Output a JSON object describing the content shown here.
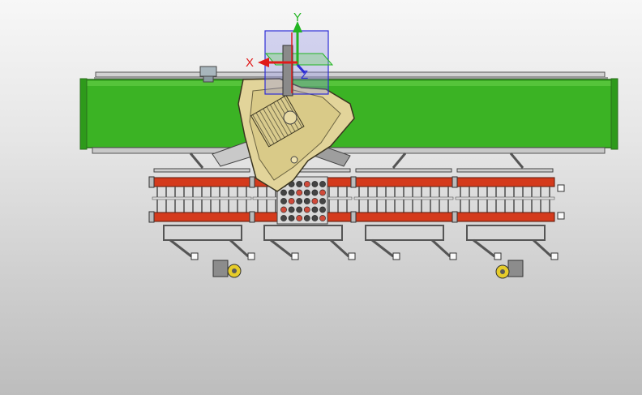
{
  "viewport": {
    "background_top": "#f7f7f7",
    "background_bottom": "#bdbdbd"
  },
  "triad": {
    "x_label": "X",
    "y_label": "Y",
    "z_label": "Z",
    "x_color": "#e01a1a",
    "y_color": "#22b522",
    "z_color": "#2d2dd6"
  },
  "model": {
    "frame_color": "#3bb324",
    "roller_color": "#d43a1c",
    "housing_color": "#e2d49a",
    "caster_color": "#e6cc2a",
    "steel_color": "#6e6e6e"
  }
}
